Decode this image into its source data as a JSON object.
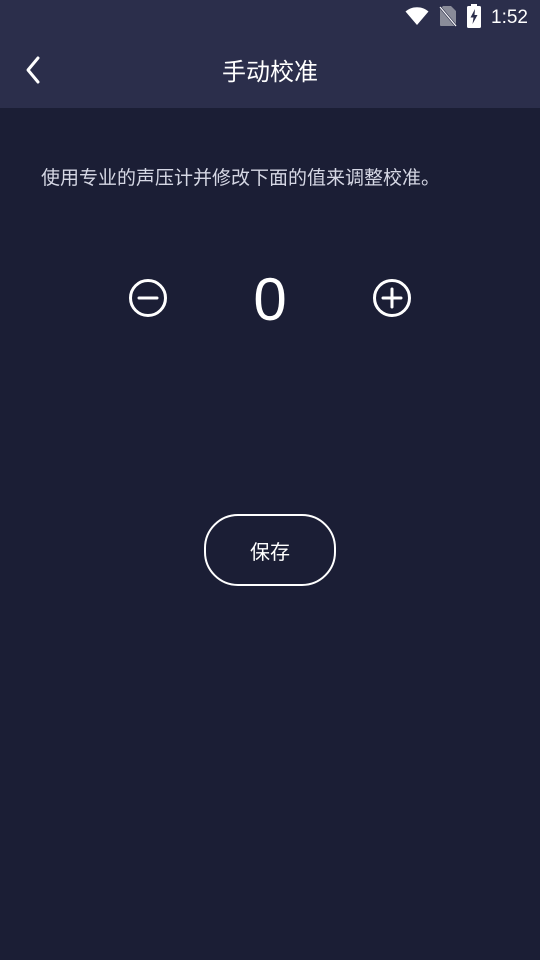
{
  "status_bar": {
    "time": "1:52",
    "icons": [
      "wifi-icon",
      "no-sim-icon",
      "battery-charging-icon"
    ]
  },
  "header": {
    "title": "手动校准",
    "back_icon": "chevron-left-icon"
  },
  "main": {
    "instruction": "使用专业的声压计并修改下面的值来调整校准。",
    "stepper": {
      "value": "0",
      "decrement_icon": "minus-circle-icon",
      "increment_icon": "plus-circle-icon"
    },
    "save_label": "保存"
  },
  "colors": {
    "background": "#1b1e35",
    "app_bar": "#2b2e4b",
    "text": "#ffffff",
    "secondary_text": "#d5d7e4"
  }
}
